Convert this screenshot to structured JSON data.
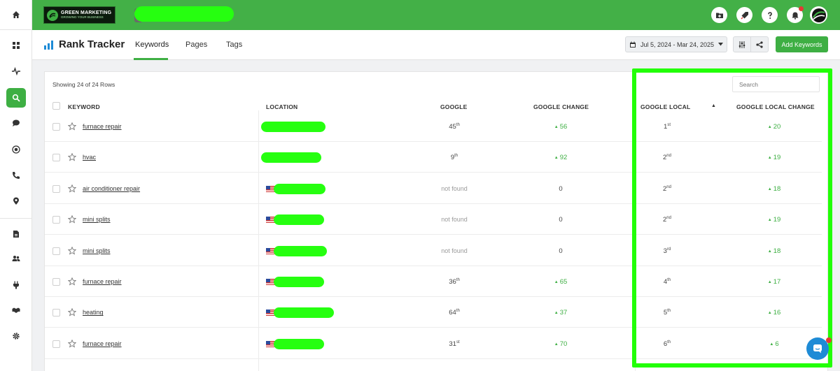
{
  "brand": {
    "line1": "GREEN MARKETING",
    "line2": "GROWING YOUR BUSINESS",
    "accent": "#43b047",
    "highlight": "#22ff06"
  },
  "header": {
    "title": "Rank Tracker",
    "tabs": [
      {
        "label": "Keywords",
        "active": true
      },
      {
        "label": "Pages",
        "active": false
      },
      {
        "label": "Tags",
        "active": false
      }
    ],
    "date_range": "Jul 5, 2024 - Mar 24, 2025",
    "add_keywords": "Add Keywords"
  },
  "sidebar": {
    "icons": [
      "home-icon",
      "dashboard-icon",
      "activity-icon",
      "search-icon",
      "chat-icon",
      "target-icon",
      "phone-icon",
      "location-icon",
      "document-icon",
      "users-icon",
      "plug-icon",
      "handshake-icon",
      "settings-icon"
    ]
  },
  "topbar_icons": [
    "folder-add-icon",
    "rocket-icon",
    "help-icon",
    "bell-icon"
  ],
  "table": {
    "showing": "Showing 24 of 24 Rows",
    "search_placeholder": "Search",
    "headers": {
      "keyword": "KEYWORD",
      "location": "LOCATION",
      "google": "GOOGLE",
      "google_change": "GOOGLE CHANGE",
      "google_local": "GOOGLE LOCAL",
      "google_local_change": "GOOGLE LOCAL CHANGE"
    },
    "rows": [
      {
        "keyword": "furnace repair",
        "google": "45",
        "google_sup": "th",
        "google_change": "56",
        "local": "1",
        "local_sup": "st",
        "local_change": "20"
      },
      {
        "keyword": "hvac",
        "google": "9",
        "google_sup": "th",
        "google_change": "92",
        "local": "2",
        "local_sup": "nd",
        "local_change": "19"
      },
      {
        "keyword": "air conditioner repair",
        "google": "not found",
        "google_sup": "",
        "google_change": "0",
        "local": "2",
        "local_sup": "nd",
        "local_change": "18"
      },
      {
        "keyword": "mini splits",
        "google": "not found",
        "google_sup": "",
        "google_change": "0",
        "local": "2",
        "local_sup": "nd",
        "local_change": "19"
      },
      {
        "keyword": "mini splits",
        "google": "not found",
        "google_sup": "",
        "google_change": "0",
        "local": "3",
        "local_sup": "rd",
        "local_change": "18"
      },
      {
        "keyword": "furnace repair",
        "google": "36",
        "google_sup": "th",
        "google_change": "65",
        "local": "4",
        "local_sup": "th",
        "local_change": "17"
      },
      {
        "keyword": "heating",
        "google": "64",
        "google_sup": "th",
        "google_change": "37",
        "local": "5",
        "local_sup": "th",
        "local_change": "16"
      },
      {
        "keyword": "furnace repair",
        "google": "31",
        "google_sup": "st",
        "google_change": "70",
        "local": "6",
        "local_sup": "th",
        "local_change": "6"
      }
    ]
  }
}
